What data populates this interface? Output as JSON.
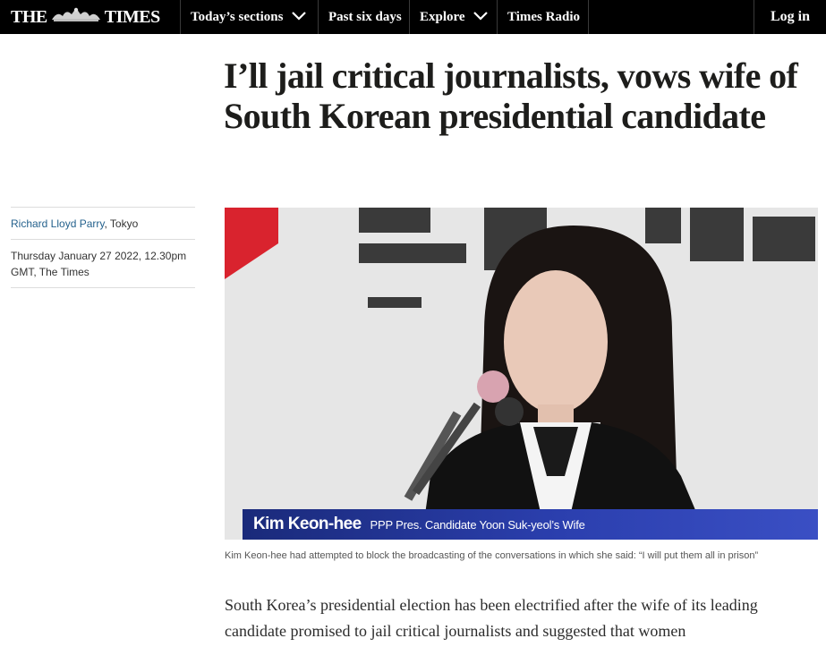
{
  "brand": {
    "logo_left": "THE",
    "logo_right": "TIMES",
    "crest_icon": "royal-crest-icon"
  },
  "nav": {
    "items": [
      {
        "label": "Today’s sections",
        "has_dropdown": true
      },
      {
        "label": "Past six days",
        "has_dropdown": false
      },
      {
        "label": "Explore",
        "has_dropdown": true
      },
      {
        "label": "Times Radio",
        "has_dropdown": false
      }
    ],
    "login_label": "Log in"
  },
  "article": {
    "headline": "I’ll jail critical journalists, vows wife of South Korean presidential candidate",
    "author": "Richard Lloyd Parry",
    "location": ", Tokyo",
    "dateline": "Thursday January 27 2022, 12.30pm GMT, The Times",
    "image": {
      "lower_third_name": "Kim Keon-hee",
      "lower_third_role": "PPP Pres. Candidate Yoon Suk-yeol’s Wife"
    },
    "caption": "Kim Keon-hee had attempted to block the broadcasting of the conversations in which she said: “I will put them all in prison”",
    "body": "South Korea’s presidential election has been electrified after the wife of its leading candidate promised to jail critical journalists and suggested that women"
  },
  "colors": {
    "nav_bg": "#000000",
    "author_link": "#25628d",
    "lower_third": "#2b3fae"
  }
}
